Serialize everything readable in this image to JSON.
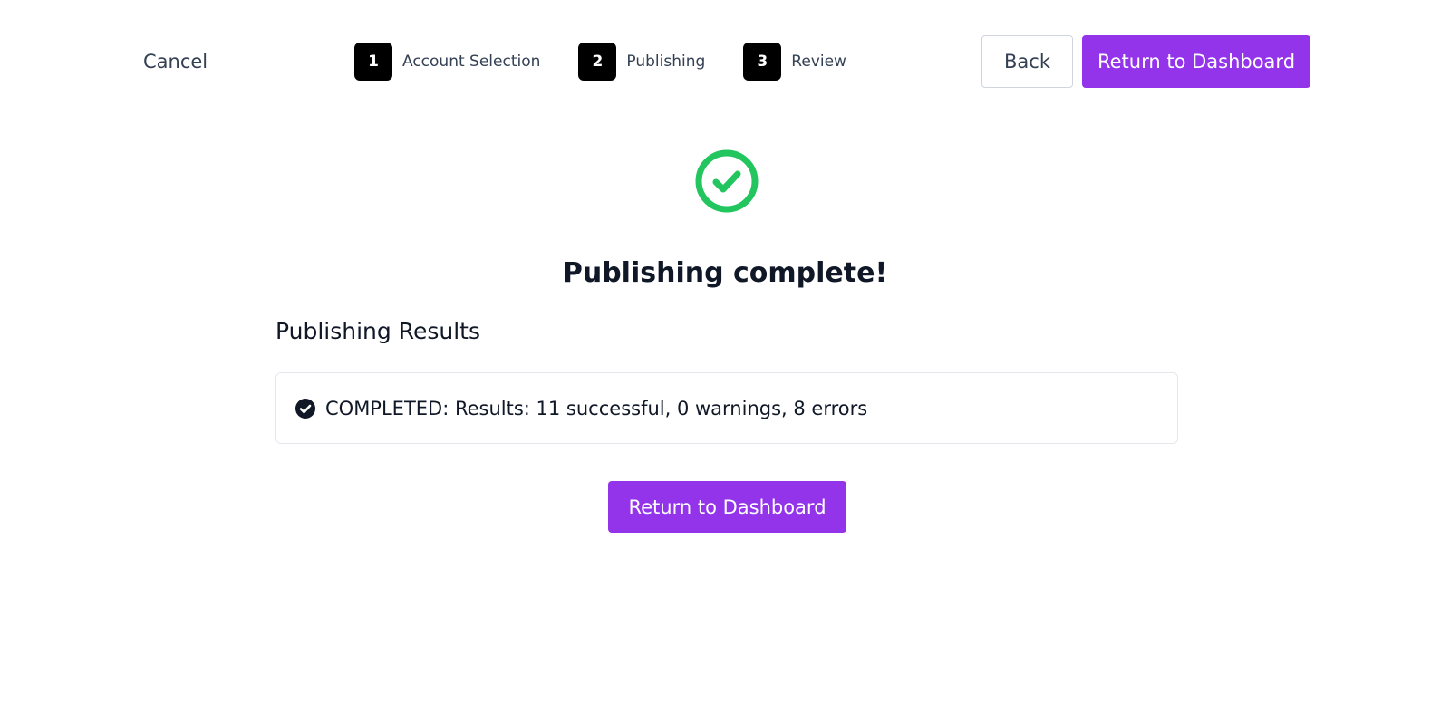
{
  "header": {
    "cancel_label": "Cancel",
    "back_label": "Back",
    "return_label": "Return to Dashboard"
  },
  "stepper": {
    "steps": [
      {
        "number": "1",
        "label": "Account Selection"
      },
      {
        "number": "2",
        "label": "Publishing"
      },
      {
        "number": "3",
        "label": "Review"
      }
    ]
  },
  "status": {
    "icon": "check-circle-icon",
    "headline": "Publishing complete!"
  },
  "results": {
    "title": "Publishing Results",
    "icon": "check-circle-filled-icon",
    "summary": "COMPLETED: Results: 11 successful, 0 warnings, 8 errors"
  },
  "footer": {
    "return_label": "Return to Dashboard"
  },
  "colors": {
    "accent": "#9333ea",
    "success": "#22c55e",
    "step_badge": "#000000",
    "text": "#101828"
  }
}
